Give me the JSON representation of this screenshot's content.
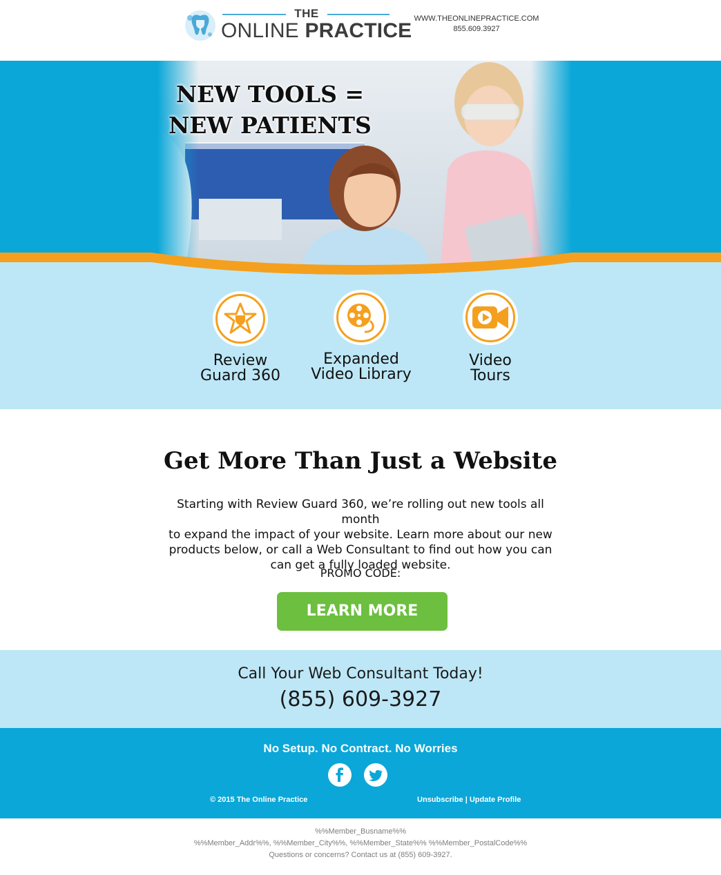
{
  "header": {
    "logo_top": "THE",
    "logo_name_light": "ONLINE",
    "logo_name_bold": "PRACTICE",
    "website": "WWW.THEONLINEPRACTICE.COM",
    "phone": "855.609.3927"
  },
  "hero": {
    "title_line1": "NEW TOOLS =",
    "title_line2": "NEW PATIENTS"
  },
  "features": [
    {
      "label_line1": "Review",
      "label_line2": "Guard 360",
      "icon": "star-shield-icon"
    },
    {
      "label_line1": "Expanded",
      "label_line2": "Video Library",
      "icon": "film-reel-icon"
    },
    {
      "label_line1": "Video",
      "label_line2": "Tours",
      "icon": "video-camera-icon"
    }
  ],
  "main": {
    "headline": "Get More Than Just a Website",
    "body_line1": "Starting with Review Guard 360, we’re rolling out new tools all month",
    "body_line2": "to expand the impact of your website. Learn more about our new",
    "body_line3": "products below, or call a Web Consultant to find out how you can",
    "body_line4": "can get a fully loaded website.",
    "promo_label": "PROMO CODE:",
    "cta_label": "LEARN MORE"
  },
  "call": {
    "line": "Call Your Web Consultant Today!",
    "phone": "(855) 609-3927"
  },
  "footer": {
    "tagline": "No Setup. No Contract. No Worries",
    "social": [
      "facebook-icon",
      "twitter-icon"
    ],
    "copyright": "© 2015 The Online Practice",
    "unsubscribe": "Unsubscribe",
    "separator": "|",
    "update_profile": "Update Profile"
  },
  "fineprint": {
    "line1": "%%Member_Busname%%",
    "line2": "%%Member_Addr%%, %%Member_City%%, %%Member_State%% %%Member_PostalCode%%",
    "line3": "Questions or concerns? Contact us at (855) 609-3927."
  },
  "colors": {
    "brand_blue": "#0aa7d8",
    "light_blue": "#bde7f6",
    "accent_orange": "#f4a01e",
    "cta_green": "#6cbf3f"
  }
}
